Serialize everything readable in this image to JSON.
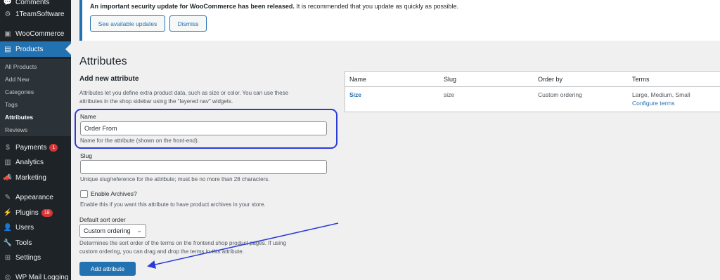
{
  "sidebar": {
    "items": [
      {
        "label": "Comments",
        "icon": "comments-icon",
        "glyph": "💬"
      },
      {
        "label": "1TeamSoftware",
        "icon": "gear-icon",
        "glyph": "⚙"
      },
      {
        "label": "WooCommerce",
        "icon": "woocommerce-icon",
        "glyph": "▣"
      },
      {
        "label": "Products",
        "icon": "products-icon",
        "glyph": "▤"
      },
      {
        "label": "Payments",
        "icon": "payments-icon",
        "glyph": "$",
        "badge": "1"
      },
      {
        "label": "Analytics",
        "icon": "analytics-icon",
        "glyph": "▥"
      },
      {
        "label": "Marketing",
        "icon": "marketing-icon",
        "glyph": "📣"
      },
      {
        "label": "Appearance",
        "icon": "appearance-icon",
        "glyph": "✎"
      },
      {
        "label": "Plugins",
        "icon": "plugins-icon",
        "glyph": "⚡",
        "badge": "18"
      },
      {
        "label": "Users",
        "icon": "users-icon",
        "glyph": "👤"
      },
      {
        "label": "Tools",
        "icon": "tools-icon",
        "glyph": "🔧"
      },
      {
        "label": "Settings",
        "icon": "settings-icon",
        "glyph": "⊞"
      },
      {
        "label": "WP Mail Logging",
        "icon": "mail-logging-icon",
        "glyph": "◎"
      }
    ],
    "submenu": [
      "All Products",
      "Add New",
      "Categories",
      "Tags",
      "Attributes",
      "Reviews"
    ]
  },
  "notice": {
    "bold_text": "An important security update for WooCommerce has been released.",
    "text": " It is recommended that you update as quickly as possible.",
    "primary_button": "See available updates",
    "dismiss_button": "Dismiss"
  },
  "page": {
    "title": "Attributes",
    "form_heading": "Add new attribute",
    "form_description_line1": "Attributes let you define extra product data, such as size or color. You can use these",
    "form_description_line2": "attributes in the shop sidebar using the \"layered nav\" widgets."
  },
  "form": {
    "name_label": "Name",
    "name_value": "Order From",
    "name_help": "Name for the attribute (shown on the front-end).",
    "slug_label": "Slug",
    "slug_value": "",
    "slug_help": "Unique slug/reference for the attribute; must be no more than 28 characters.",
    "archives_label": "Enable Archives?",
    "archives_help": "Enable this if you want this attribute to have product archives in your store.",
    "sort_label": "Default sort order",
    "sort_value": "Custom ordering",
    "sort_help_line1": "Determines the sort order of the terms on the frontend shop product pages. If using",
    "sort_help_line2": "custom ordering, you can drag and drop the terms in this attribute.",
    "submit_button": "Add attribute"
  },
  "table": {
    "headers": [
      "Name",
      "Slug",
      "Order by",
      "Terms"
    ],
    "rows": [
      {
        "name": "Size",
        "slug": "size",
        "order_by": "Custom ordering",
        "terms": "Large, Medium, Small",
        "configure": "Configure terms"
      }
    ]
  },
  "colors": {
    "accent": "#2271b1",
    "sidebar_bg": "#1d2327",
    "annotation": "#2b3bd9",
    "badge": "#d63638"
  }
}
